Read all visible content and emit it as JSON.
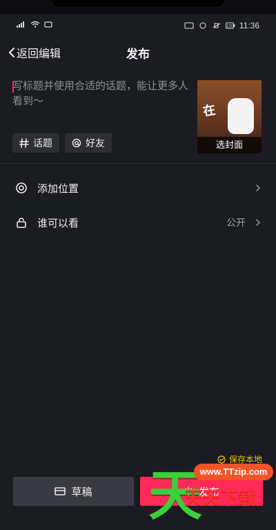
{
  "status_bar": {
    "battery_percent": "100",
    "time": "11:36"
  },
  "header": {
    "back_label": "返回编辑",
    "title": "发布"
  },
  "composer": {
    "caption_placeholder": "写标题并使用合适的话题，能让更多人看到～",
    "cover": {
      "overlay_text": "在",
      "label": "选封面"
    },
    "chips": [
      {
        "label": "话题",
        "icon": "hash-icon"
      },
      {
        "label": "好友",
        "icon": "at-icon"
      }
    ]
  },
  "settings": {
    "rows": [
      {
        "label": "添加位置",
        "value": "",
        "icon": "location-icon"
      },
      {
        "label": "谁可以看",
        "value": "公开",
        "icon": "lock-icon"
      }
    ]
  },
  "footer": {
    "save_local_label": "保存本地",
    "draft_label": "草稿",
    "publish_label": "发布"
  },
  "watermark": {
    "site": "www.TTzip.com",
    "big_char": "天",
    "text": "天天下载"
  },
  "colors": {
    "background": "#1b1b24",
    "accent": "#ff2a57",
    "save_local": "#f0c400"
  }
}
